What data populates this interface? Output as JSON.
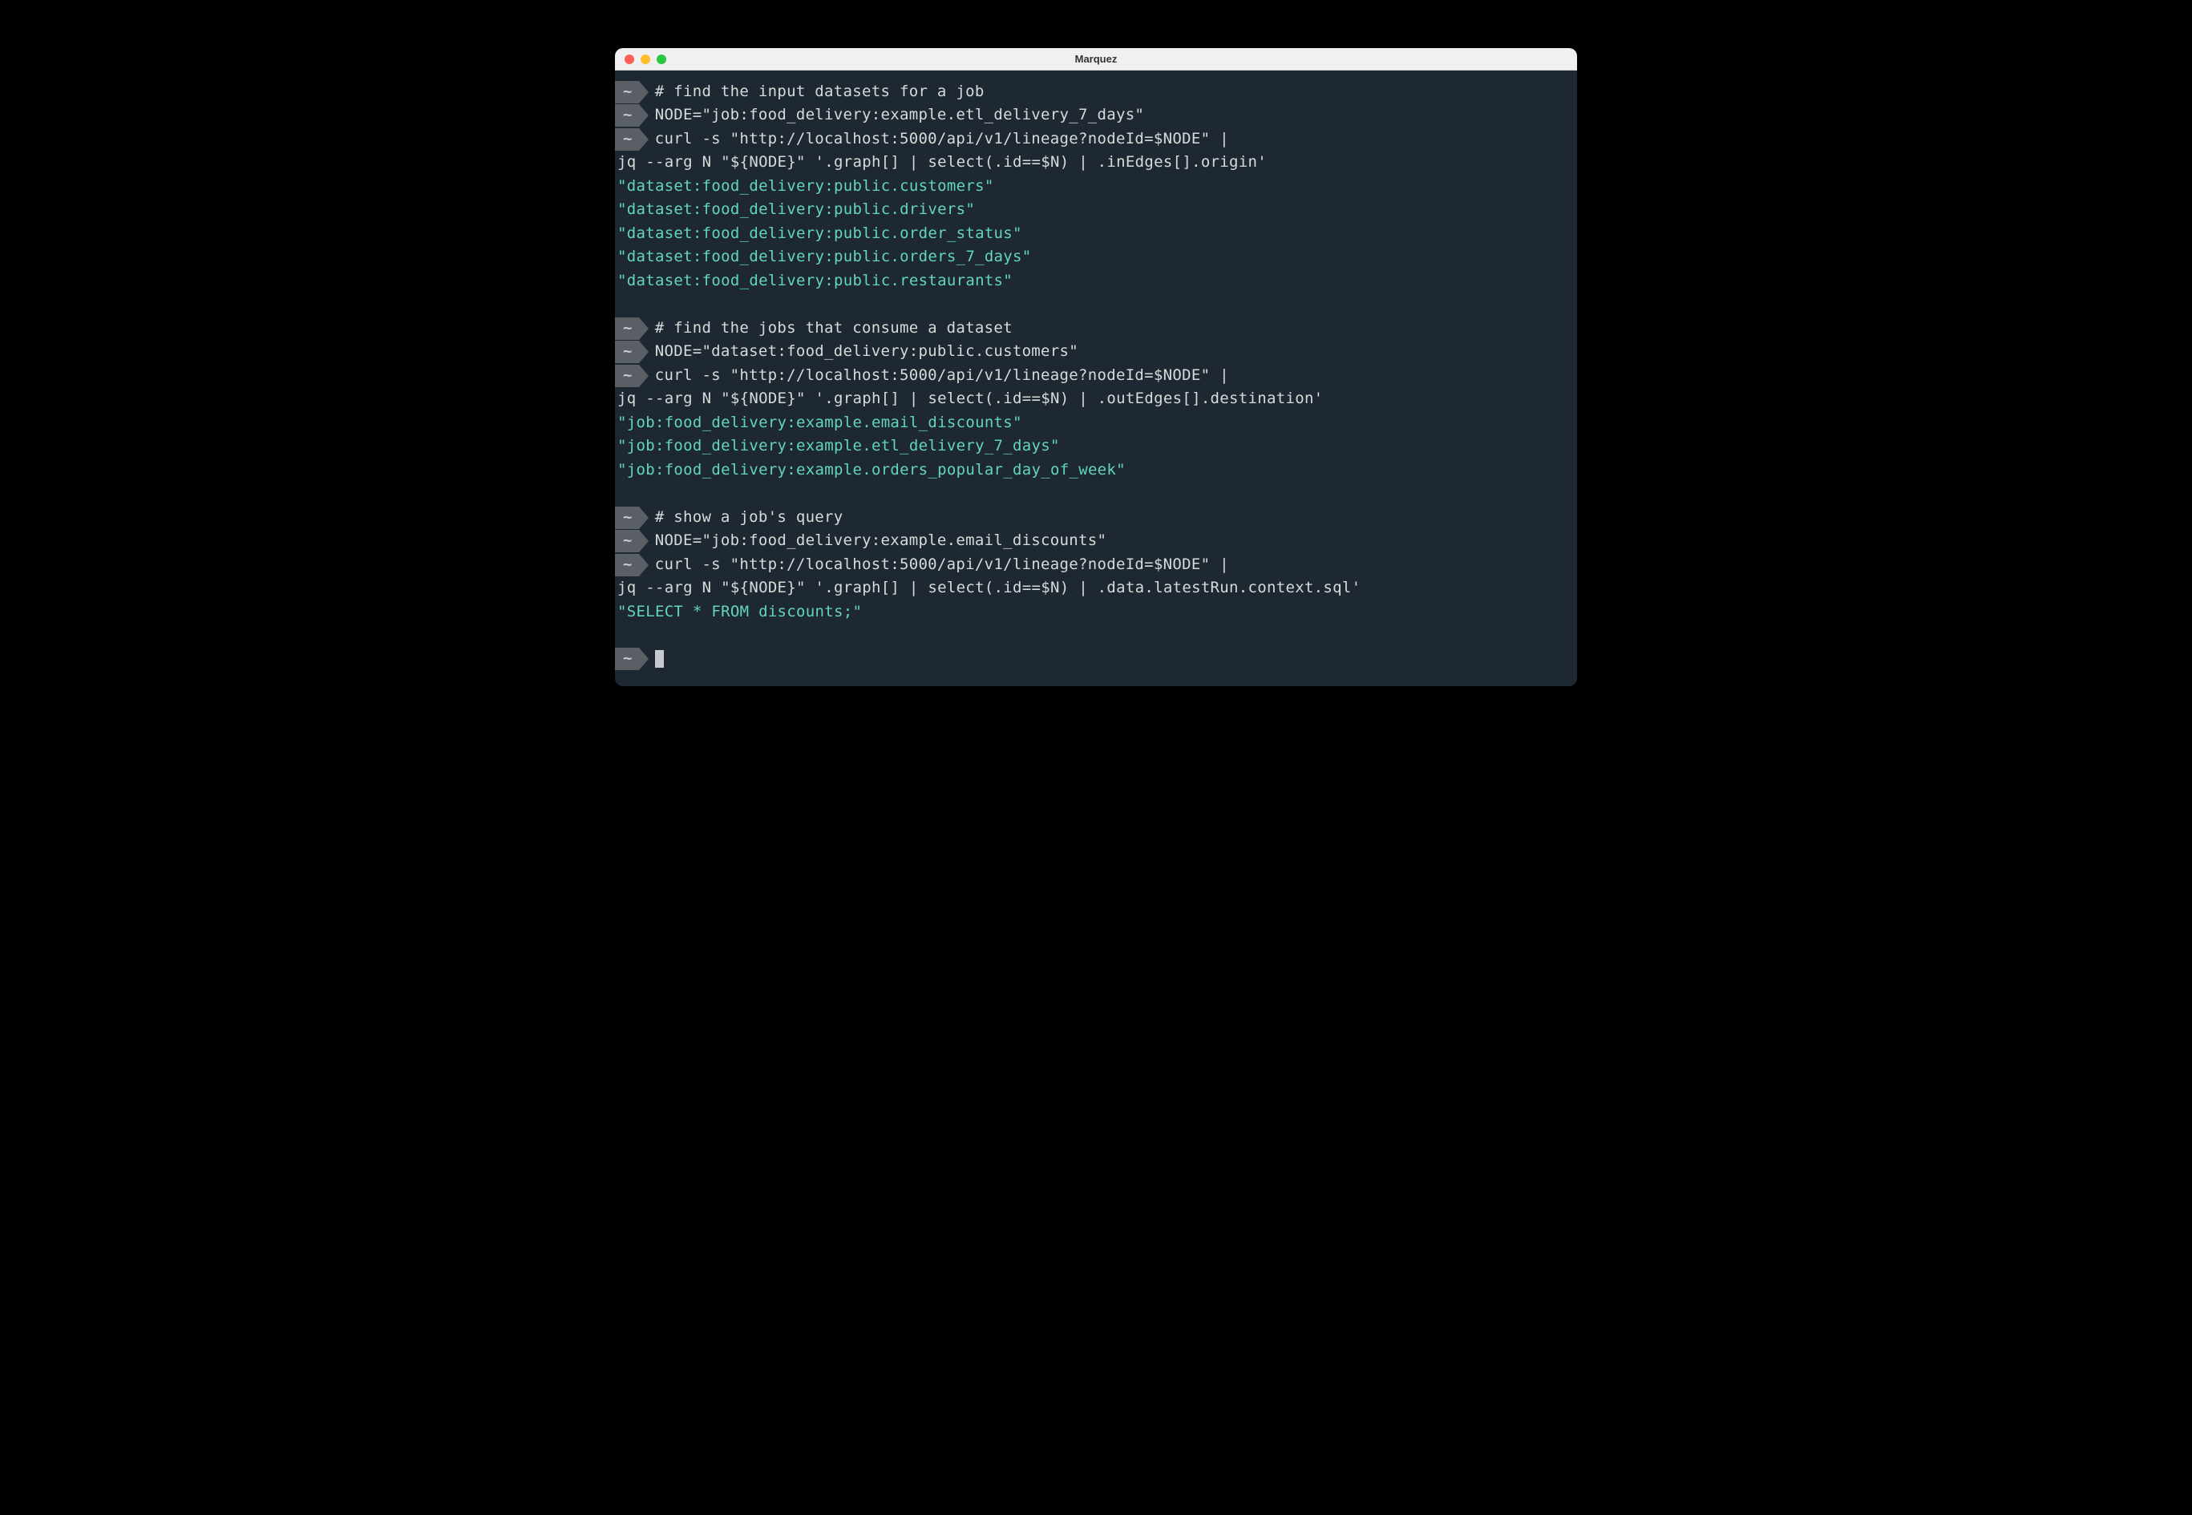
{
  "window": {
    "title": "Marquez"
  },
  "prompt": {
    "tilde": "~"
  },
  "block1": {
    "comment": "# find the input datasets for a job",
    "assign": "NODE=\"job:food_delivery:example.etl_delivery_7_days\"",
    "curl": "curl -s \"http://localhost:5000/api/v1/lineage?nodeId=$NODE\" |",
    "jq": "jq --arg N \"${NODE}\" '.graph[] | select(.id==$N) | .inEdges[].origin'",
    "output": [
      "\"dataset:food_delivery:public.customers\"",
      "\"dataset:food_delivery:public.drivers\"",
      "\"dataset:food_delivery:public.order_status\"",
      "\"dataset:food_delivery:public.orders_7_days\"",
      "\"dataset:food_delivery:public.restaurants\""
    ]
  },
  "block2": {
    "comment": "# find the jobs that consume a dataset",
    "assign": "NODE=\"dataset:food_delivery:public.customers\"",
    "curl": "curl -s \"http://localhost:5000/api/v1/lineage?nodeId=$NODE\" |",
    "jq": "jq --arg N \"${NODE}\" '.graph[] | select(.id==$N) | .outEdges[].destination'",
    "output": [
      "\"job:food_delivery:example.email_discounts\"",
      "\"job:food_delivery:example.etl_delivery_7_days\"",
      "\"job:food_delivery:example.orders_popular_day_of_week\""
    ]
  },
  "block3": {
    "comment": "# show a job's query",
    "assign": "NODE=\"job:food_delivery:example.email_discounts\"",
    "curl": "curl -s \"http://localhost:5000/api/v1/lineage?nodeId=$NODE\" |",
    "jq": "jq --arg N \"${NODE}\" '.graph[] | select(.id==$N) | .data.latestRun.context.sql'",
    "output": [
      "\"SELECT * FROM discounts;\""
    ]
  }
}
